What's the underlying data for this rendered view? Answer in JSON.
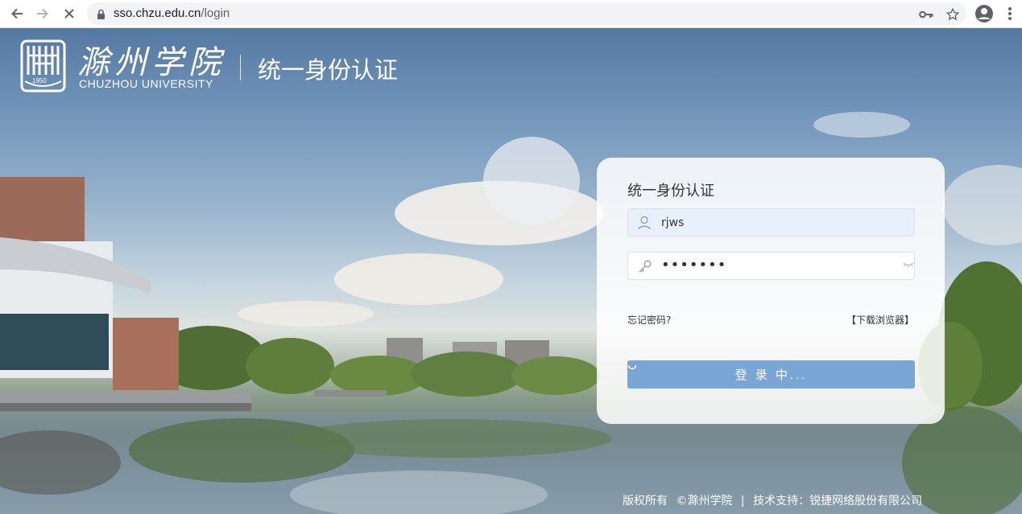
{
  "browser": {
    "url_host": "sso.chzu.edu.cn",
    "url_path": "/login",
    "icons": [
      "back-arrow-icon",
      "forward-arrow-icon",
      "stop-loading-icon",
      "lock-icon",
      "key-icon",
      "star-icon",
      "account-icon",
      "more-vert-icon"
    ]
  },
  "header": {
    "logo_year": "1950",
    "logo_cn": "滁州学院",
    "logo_en": "CHUZHOU UNIVERSITY",
    "system_name": "统一身份认证"
  },
  "login": {
    "title": "统一身份认证",
    "username_value": "rjws",
    "password_mask": "•••••••",
    "forgot_link": "忘记密码?",
    "download_link": "【下载浏览器】",
    "submit_label": "登 录 中...",
    "submit_color": "#7aa6d6"
  },
  "footer": {
    "copyright_label": "版权所有",
    "copyright": "©滁州学院",
    "separator": "|",
    "support": "技术支持：锐捷网络股份有限公司"
  }
}
